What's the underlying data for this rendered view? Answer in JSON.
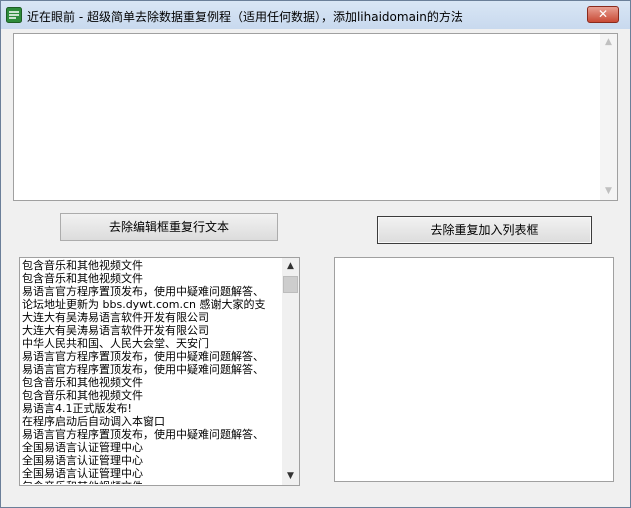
{
  "window": {
    "title": "近在眼前 - 超级简单去除数据重复例程（适用任何数据），添加lihaidomain的方法",
    "close_label": "✕"
  },
  "editor": {
    "value": ""
  },
  "buttons": {
    "remove_edit_duplicates": "去除编辑框重复行文本",
    "remove_duplicates_to_list": "去除重复加入列表框"
  },
  "list_left": {
    "items": [
      "包含音乐和其他视频文件",
      "包含音乐和其他视频文件",
      "易语言官方程序置顶发布，使用中疑难问题解答、",
      "论坛地址更新为 bbs.dywt.com.cn 感谢大家的支",
      "大连大有吴涛易语言软件开发有限公司",
      "大连大有吴涛易语言软件开发有限公司",
      "中华人民共和国、人民大会堂、天安门",
      "易语言官方程序置顶发布，使用中疑难问题解答、",
      "易语言官方程序置顶发布，使用中疑难问题解答、",
      "包含音乐和其他视频文件",
      "包含音乐和其他视频文件",
      "易语言4.1正式版发布!",
      "在程序启动后自动调入本窗口",
      "易语言官方程序置顶发布，使用中疑难问题解答、",
      "全国易语言认证管理中心",
      "全国易语言认证管理中心",
      "全国易语言认证管理中心",
      "包含音乐和其他视频文件"
    ]
  },
  "list_right": {
    "items": []
  },
  "icons": {
    "app": "app-icon",
    "scroll_up": "chevron-up-icon",
    "scroll_down": "chevron-down-icon"
  }
}
